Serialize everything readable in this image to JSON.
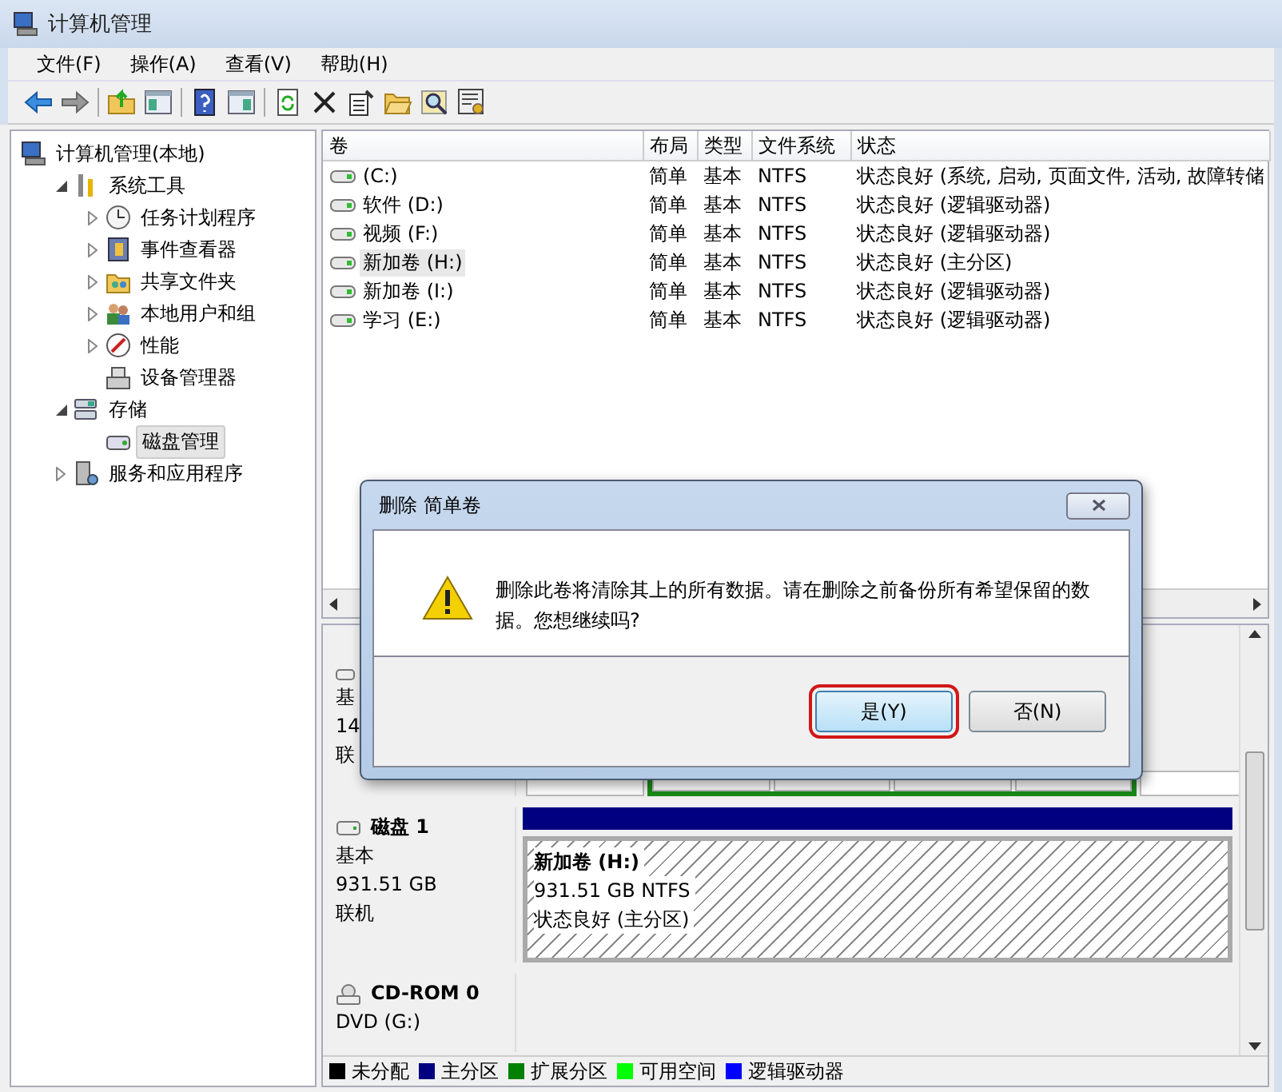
{
  "window": {
    "title": "计算机管理"
  },
  "menu": [
    "文件(F)",
    "操作(A)",
    "查看(V)",
    "帮助(H)"
  ],
  "tree": [
    {
      "label": "计算机管理(本地)",
      "selected": false,
      "children": [
        {
          "label": "系统工具",
          "expanded": true,
          "selected": false,
          "children": [
            {
              "label": "任务计划程序",
              "expanded": false,
              "selected": false
            },
            {
              "label": "事件查看器",
              "expanded": false,
              "selected": false
            },
            {
              "label": "共享文件夹",
              "expanded": false,
              "selected": false
            },
            {
              "label": "本地用户和组",
              "expanded": false,
              "selected": false
            },
            {
              "label": "性能",
              "expanded": false,
              "selected": false
            },
            {
              "label": "设备管理器",
              "selected": false
            }
          ]
        },
        {
          "label": "存储",
          "expanded": true,
          "selected": false,
          "children": [
            {
              "label": "磁盘管理",
              "selected": true
            }
          ]
        },
        {
          "label": "服务和应用程序",
          "expanded": false,
          "selected": false
        }
      ]
    }
  ],
  "volumes": {
    "columns": [
      "卷",
      "布局",
      "类型",
      "文件系统",
      "状态"
    ],
    "rows": [
      {
        "name": " (C:)",
        "layout": "简单",
        "type": "基本",
        "fs": "NTFS",
        "status": "状态良好 (系统, 启动, 页面文件, 活动, 故障转储",
        "selected": false
      },
      {
        "name": "软件 (D:)",
        "layout": "简单",
        "type": "基本",
        "fs": "NTFS",
        "status": "状态良好 (逻辑驱动器)",
        "selected": false
      },
      {
        "name": "视频 (F:)",
        "layout": "简单",
        "type": "基本",
        "fs": "NTFS",
        "status": "状态良好 (逻辑驱动器)",
        "selected": false
      },
      {
        "name": "新加卷 (H:)",
        "layout": "简单",
        "type": "基本",
        "fs": "NTFS",
        "status": "状态良好 (主分区)",
        "selected": true
      },
      {
        "name": "新加卷 (I:)",
        "layout": "简单",
        "type": "基本",
        "fs": "NTFS",
        "status": "状态良好 (逻辑驱动器)",
        "selected": false
      },
      {
        "name": "学习 (E:)",
        "layout": "简单",
        "type": "基本",
        "fs": "NTFS",
        "status": "状态良好 (逻辑驱动器)",
        "selected": false
      }
    ]
  },
  "disks": [
    {
      "kind": "partial",
      "lines": [
        "基",
        "14",
        "联"
      ]
    },
    {
      "kind": "disk",
      "name": "磁盘 1",
      "lines": [
        "基本",
        "931.51 GB",
        "联机"
      ],
      "partitions": [
        {
          "color": "#000080",
          "name": "新加卷  (H:)",
          "size": "931.51 GB NTFS",
          "status": "状态良好 (主分区)",
          "selected": true
        }
      ]
    },
    {
      "kind": "cdrom",
      "name": "CD-ROM 0",
      "lines": [
        "DVD (G:)"
      ]
    }
  ],
  "legend": [
    {
      "label": "未分配",
      "color": "#000000"
    },
    {
      "label": "主分区",
      "color": "#000080"
    },
    {
      "label": "扩展分区",
      "color": "#008000"
    },
    {
      "label": "可用空间",
      "color": "#00ff00"
    },
    {
      "label": "逻辑驱动器",
      "color": "#0000ff"
    }
  ],
  "dialog": {
    "title": "删除 简单卷",
    "message": "删除此卷将清除其上的所有数据。请在删除之前备份所有希望保留的数据。您想继续吗?",
    "buttons": [
      {
        "label": "是(Y)",
        "highlighted": true
      },
      {
        "label": "否(N)",
        "highlighted": false
      }
    ]
  }
}
